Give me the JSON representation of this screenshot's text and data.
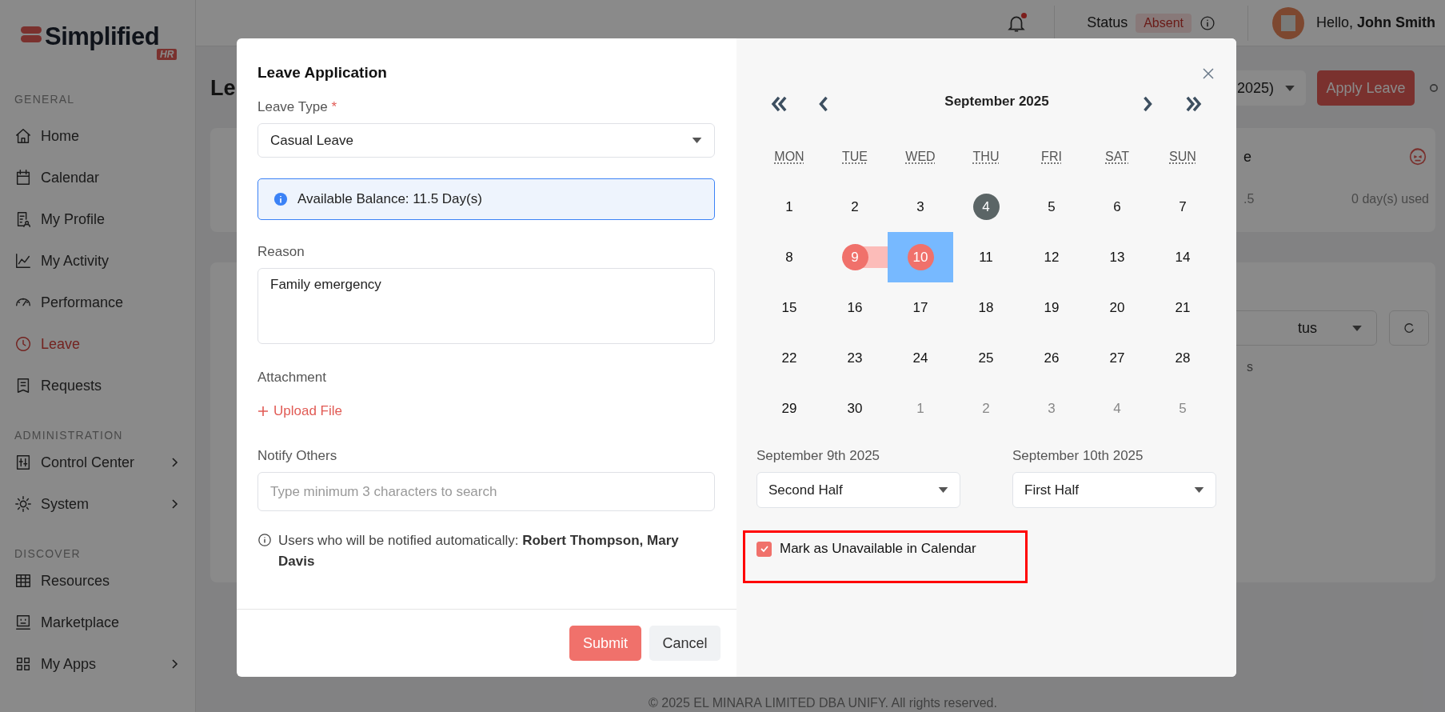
{
  "sidebar": {
    "logo": {
      "name": "Simplified",
      "badge": "HR"
    },
    "sections": [
      {
        "title": "GENERAL",
        "items": [
          {
            "label": "Home",
            "selected": false,
            "has_submenu": false
          },
          {
            "label": "Calendar",
            "selected": false,
            "has_submenu": false
          },
          {
            "label": "My Profile",
            "selected": false,
            "has_submenu": false
          },
          {
            "label": "My Activity",
            "selected": false,
            "has_submenu": false
          },
          {
            "label": "Performance",
            "selected": false,
            "has_submenu": false
          },
          {
            "label": "Leave",
            "selected": true,
            "has_submenu": false
          },
          {
            "label": "Requests",
            "selected": false,
            "has_submenu": false
          }
        ]
      },
      {
        "title": "ADMINISTRATION",
        "items": [
          {
            "label": "Control Center",
            "selected": false,
            "has_submenu": true
          },
          {
            "label": "System",
            "selected": false,
            "has_submenu": true
          }
        ]
      },
      {
        "title": "DISCOVER",
        "items": [
          {
            "label": "Resources",
            "selected": false,
            "has_submenu": false
          },
          {
            "label": "Marketplace",
            "selected": false,
            "has_submenu": false
          },
          {
            "label": "My Apps",
            "selected": false,
            "has_submenu": true
          }
        ]
      }
    ]
  },
  "top_bar": {
    "notification_unread": true,
    "status_label": "Status",
    "status_value": "Absent",
    "greeting": "Hello, **John Smith**"
  },
  "page": {
    "title": "Le",
    "period_select": "2025)",
    "apply_button": "Apply Leave",
    "card": {
      "title": "e",
      "balance": ".5",
      "used": "0 day(s) used"
    },
    "filter_select": "tus",
    "table_header": "s",
    "footer": "© 2025 EL MINARA LIMITED DBA UNIFY. All rights reserved."
  },
  "dialog": {
    "title": "Leave Application",
    "leave_type": {
      "label": "Leave Type",
      "required_mark": "*",
      "value": "Casual Leave"
    },
    "balance_note": "Available Balance: 11.5 Day(s)",
    "reason": {
      "label": "Reason",
      "value": "Family emergency"
    },
    "attachment": {
      "label": "Attachment",
      "action": "Upload File"
    },
    "notify": {
      "label": "Notify Others",
      "placeholder": "Type minimum 3 characters to search"
    },
    "auto_notify_note": "Users who will be notified automatically: **Robert Thompson, Mary Davis**",
    "buttons": [
      {
        "label": "Submit",
        "kind": "primary"
      },
      {
        "label": "Cancel",
        "kind": "secondary"
      }
    ],
    "calendar": {
      "month": "September 2025",
      "weekdays": [
        "MON",
        "TUE",
        "WED",
        "THU",
        "FRI",
        "SAT",
        "SUN"
      ],
      "weeks": [
        [
          {
            "label": "1",
            "muted": false,
            "today": false,
            "selected": false,
            "hovered": false
          },
          {
            "label": "2",
            "muted": false,
            "today": false,
            "selected": false,
            "hovered": false
          },
          {
            "label": "3",
            "muted": false,
            "today": false,
            "selected": false,
            "hovered": false
          },
          {
            "label": "4",
            "muted": false,
            "today": true,
            "selected": false,
            "hovered": false
          },
          {
            "label": "5",
            "muted": false,
            "today": false,
            "selected": false,
            "hovered": false
          },
          {
            "label": "6",
            "muted": false,
            "today": false,
            "selected": false,
            "hovered": false
          },
          {
            "label": "7",
            "muted": false,
            "today": false,
            "selected": false,
            "hovered": false
          }
        ],
        [
          {
            "label": "8",
            "muted": false,
            "today": false,
            "selected": false,
            "hovered": false
          },
          {
            "label": "9",
            "muted": false,
            "today": false,
            "selected": true,
            "hovered": false
          },
          {
            "label": "10",
            "muted": false,
            "today": false,
            "selected": true,
            "hovered": true
          },
          {
            "label": "11",
            "muted": false,
            "today": false,
            "selected": false,
            "hovered": false
          },
          {
            "label": "12",
            "muted": false,
            "today": false,
            "selected": false,
            "hovered": false
          },
          {
            "label": "13",
            "muted": false,
            "today": false,
            "selected": false,
            "hovered": false
          },
          {
            "label": "14",
            "muted": false,
            "today": false,
            "selected": false,
            "hovered": false
          }
        ],
        [
          {
            "label": "15",
            "muted": false,
            "today": false,
            "selected": false,
            "hovered": false
          },
          {
            "label": "16",
            "muted": false,
            "today": false,
            "selected": false,
            "hovered": false
          },
          {
            "label": "17",
            "muted": false,
            "today": false,
            "selected": false,
            "hovered": false
          },
          {
            "label": "18",
            "muted": false,
            "today": false,
            "selected": false,
            "hovered": false
          },
          {
            "label": "19",
            "muted": false,
            "today": false,
            "selected": false,
            "hovered": false
          },
          {
            "label": "20",
            "muted": false,
            "today": false,
            "selected": false,
            "hovered": false
          },
          {
            "label": "21",
            "muted": false,
            "today": false,
            "selected": false,
            "hovered": false
          }
        ],
        [
          {
            "label": "22",
            "muted": false,
            "today": false,
            "selected": false,
            "hovered": false
          },
          {
            "label": "23",
            "muted": false,
            "today": false,
            "selected": false,
            "hovered": false
          },
          {
            "label": "24",
            "muted": false,
            "today": false,
            "selected": false,
            "hovered": false
          },
          {
            "label": "25",
            "muted": false,
            "today": false,
            "selected": false,
            "hovered": false
          },
          {
            "label": "26",
            "muted": false,
            "today": false,
            "selected": false,
            "hovered": false
          },
          {
            "label": "27",
            "muted": false,
            "today": false,
            "selected": false,
            "hovered": false
          },
          {
            "label": "28",
            "muted": false,
            "today": false,
            "selected": false,
            "hovered": false
          }
        ],
        [
          {
            "label": "29",
            "muted": false,
            "today": false,
            "selected": false,
            "hovered": false
          },
          {
            "label": "30",
            "muted": false,
            "today": false,
            "selected": false,
            "hovered": false
          },
          {
            "label": "1",
            "muted": true,
            "today": false,
            "selected": false,
            "hovered": false
          },
          {
            "label": "2",
            "muted": true,
            "today": false,
            "selected": false,
            "hovered": false
          },
          {
            "label": "3",
            "muted": true,
            "today": false,
            "selected": false,
            "hovered": false
          },
          {
            "label": "4",
            "muted": true,
            "today": false,
            "selected": false,
            "hovered": false
          },
          {
            "label": "5",
            "muted": true,
            "today": false,
            "selected": false,
            "hovered": false
          }
        ]
      ]
    },
    "half_days": [
      {
        "date": "September 9th 2025",
        "value": "Second Half"
      },
      {
        "date": "September 10th 2025",
        "value": "First Half"
      }
    ],
    "unavailable": {
      "label": "Mark as Unavailable in Calendar",
      "checked": true,
      "highlighted": true
    }
  }
}
